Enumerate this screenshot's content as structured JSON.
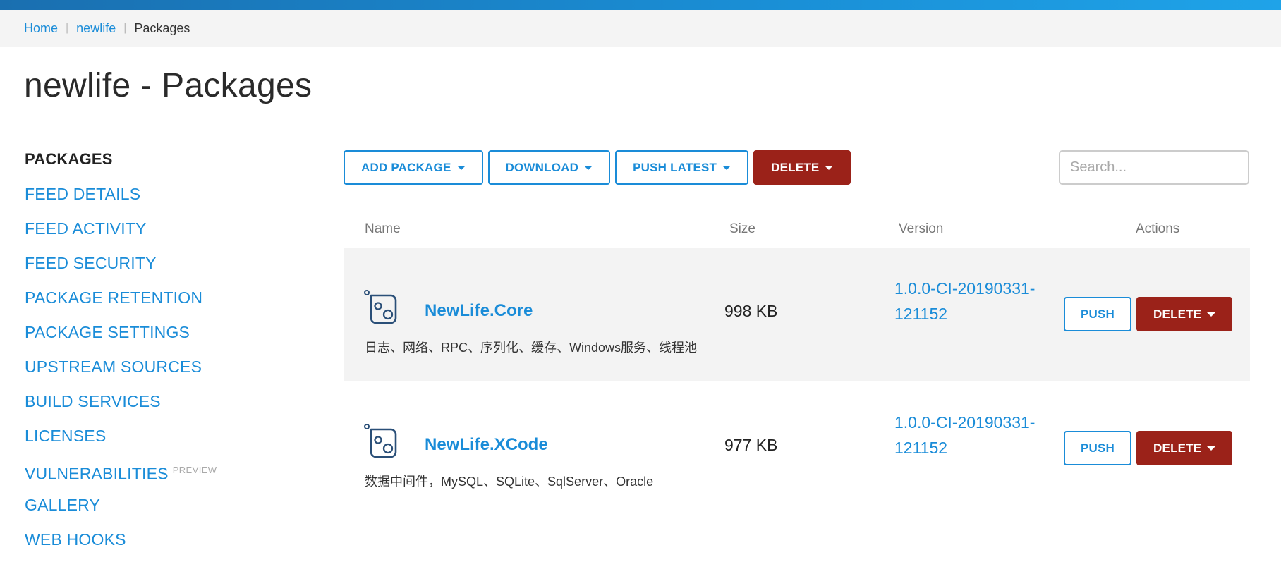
{
  "breadcrumb": {
    "items": [
      "Home",
      "newlife"
    ],
    "current": "Packages"
  },
  "page": {
    "title": "newlife - Packages"
  },
  "sidebar": {
    "items": [
      {
        "label": "PACKAGES",
        "active": true
      },
      {
        "label": "FEED DETAILS"
      },
      {
        "label": "FEED ACTIVITY"
      },
      {
        "label": "FEED SECURITY"
      },
      {
        "label": "PACKAGE RETENTION"
      },
      {
        "label": "PACKAGE SETTINGS"
      },
      {
        "label": "UPSTREAM SOURCES"
      },
      {
        "label": "BUILD SERVICES"
      },
      {
        "label": "LICENSES"
      },
      {
        "label": "VULNERABILITIES",
        "badge": "PREVIEW"
      },
      {
        "label": "GALLERY"
      },
      {
        "label": "WEB HOOKS"
      }
    ]
  },
  "toolbar": {
    "add_package": "ADD PACKAGE",
    "download": "DOWNLOAD",
    "push_latest": "PUSH LATEST",
    "delete": "DELETE",
    "search_placeholder": "Search..."
  },
  "table": {
    "headers": {
      "name": "Name",
      "size": "Size",
      "version": "Version",
      "actions": "Actions"
    },
    "rows": [
      {
        "name": "NewLife.Core",
        "description": "日志、网络、RPC、序列化、缓存、Windows服务、线程池",
        "size": "998 KB",
        "version_line1": "1.0.0-CI-20190331-",
        "version_line2": "121152",
        "push": "PUSH",
        "delete": "DELETE"
      },
      {
        "name": "NewLife.XCode",
        "description": "数据中间件，MySQL、SQLite、SqlServer、Oracle",
        "size": "977 KB",
        "version_line1": "1.0.0-CI-20190331-",
        "version_line2": "121152",
        "push": "PUSH",
        "delete": "DELETE"
      }
    ]
  },
  "colors": {
    "accent": "#1a8cd8",
    "danger": "#9b2219",
    "row_shade": "#f3f3f3"
  }
}
